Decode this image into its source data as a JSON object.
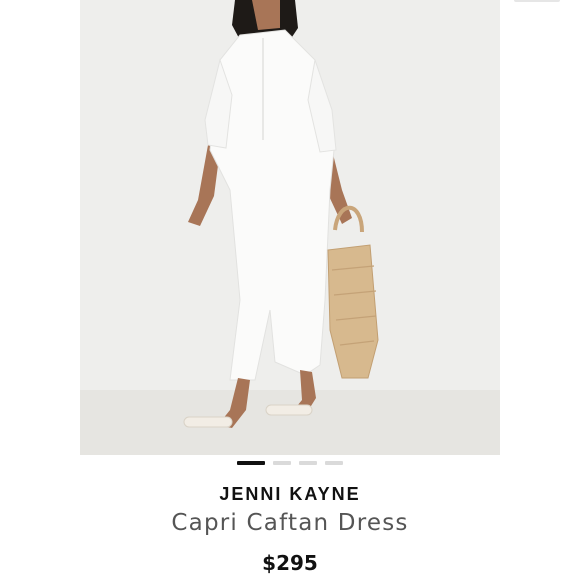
{
  "product": {
    "brand": "JENNI KAYNE",
    "name": "Capri Caftan Dress",
    "price": "$295",
    "image_alt": "Model wearing white caftan dress with woven straw tote"
  },
  "carousel": {
    "count": 4,
    "active_index": 0
  },
  "colors": {
    "active_dot": "#111111",
    "inactive_dot": "#dadada",
    "background": "#ffffff"
  }
}
